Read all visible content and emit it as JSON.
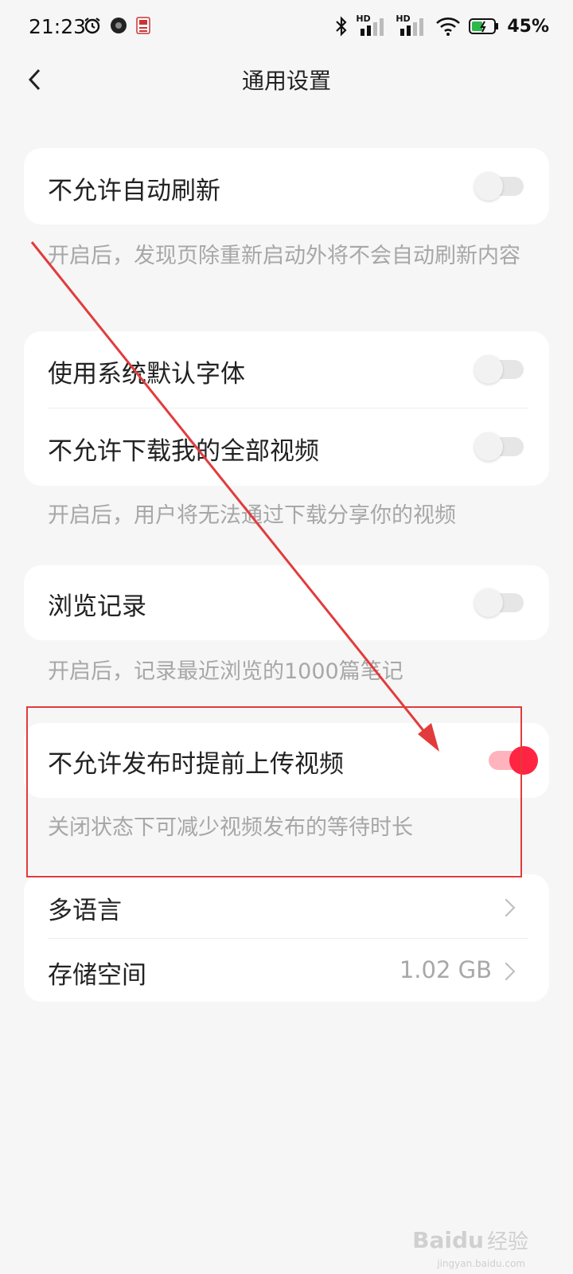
{
  "status_bar": {
    "time": "21:23",
    "battery": "45%",
    "icons": [
      "alarm-icon",
      "camera-icon",
      "app-badge-icon",
      "bluetooth-icon",
      "signal-icon",
      "signal-icon",
      "wifi-icon",
      "battery-icon"
    ],
    "hd1": "HD",
    "hd2": "HD"
  },
  "header": {
    "title": "通用设置"
  },
  "settings": {
    "auto_refresh": {
      "label": "不允许自动刷新",
      "on": false,
      "note": "开启后，发现页除重新启动外将不会自动刷新内容"
    },
    "system_font": {
      "label": "使用系统默认字体",
      "on": false
    },
    "download_videos": {
      "label": "不允许下载我的全部视频",
      "on": false,
      "note": "开启后，用户将无法通过下载分享你的视频"
    },
    "browse_history": {
      "label": "浏览记录",
      "on": false,
      "note": "开启后，记录最近浏览的1000篇笔记"
    },
    "pre_upload": {
      "label": "不允许发布时提前上传视频",
      "on": true,
      "note": "关闭状态下可减少视频发布的等待时长"
    },
    "language": {
      "label": "多语言"
    },
    "storage": {
      "label": "存储空间",
      "value": "1.02 GB"
    }
  },
  "watermark": {
    "brand": "Baidu",
    "text": "经验",
    "domain": "jingyan.baidu.com"
  },
  "colors": {
    "accent": "#ff2442",
    "annotation": "#e23b3b",
    "background": "#f6f6f6"
  }
}
